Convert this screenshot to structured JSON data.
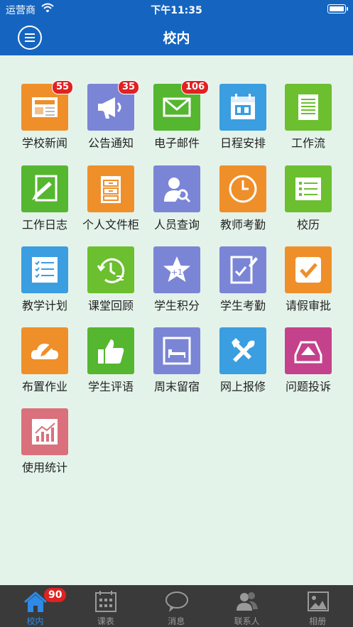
{
  "status": {
    "carrier": "运营商",
    "time": "下午11:35"
  },
  "nav": {
    "title": "校内"
  },
  "colors": {
    "header": "#1565c0",
    "badge": "#e02222",
    "tab_active": "#2e8ae6"
  },
  "apps": [
    {
      "label": "学校新闻",
      "icon": "news-icon",
      "color": "#ef8f2a",
      "badge": "55"
    },
    {
      "label": "公告通知",
      "icon": "megaphone-icon",
      "color": "#7b85d6",
      "badge": "35"
    },
    {
      "label": "电子邮件",
      "icon": "envelope-icon",
      "color": "#55b630",
      "badge": "106"
    },
    {
      "label": "日程安排",
      "icon": "calendar-icon",
      "color": "#3a9ee0",
      "badge": ""
    },
    {
      "label": "工作流",
      "icon": "document-icon",
      "color": "#6cbf2f",
      "badge": ""
    },
    {
      "label": "工作日志",
      "icon": "pencil-note-icon",
      "color": "#55b630",
      "badge": ""
    },
    {
      "label": "个人文件柜",
      "icon": "cabinet-icon",
      "color": "#ef8f2a",
      "badge": ""
    },
    {
      "label": "人员查询",
      "icon": "person-search-icon",
      "color": "#7b85d6",
      "badge": ""
    },
    {
      "label": "教师考勤",
      "icon": "clock-icon",
      "color": "#ef8f2a",
      "badge": ""
    },
    {
      "label": "校历",
      "icon": "list-icon",
      "color": "#6cbf2f",
      "badge": ""
    },
    {
      "label": "教学计划",
      "icon": "checklist-icon",
      "color": "#3a9ee0",
      "badge": ""
    },
    {
      "label": "课堂回顾",
      "icon": "history-icon",
      "color": "#6cbf2f",
      "badge": ""
    },
    {
      "label": "学生积分",
      "icon": "star-icon",
      "color": "#7b85d6",
      "badge": "",
      "icon_text": "+1"
    },
    {
      "label": "学生考勤",
      "icon": "check-edit-icon",
      "color": "#7b85d6",
      "badge": ""
    },
    {
      "label": "请假审批",
      "icon": "approve-icon",
      "color": "#ef8f2a",
      "badge": ""
    },
    {
      "label": "布置作业",
      "icon": "cloud-pencil-icon",
      "color": "#ef8f2a",
      "badge": ""
    },
    {
      "label": "学生评语",
      "icon": "thumbs-up-icon",
      "color": "#55b630",
      "badge": ""
    },
    {
      "label": "周末留宿",
      "icon": "bed-icon",
      "color": "#7b85d6",
      "badge": ""
    },
    {
      "label": "网上报修",
      "icon": "tools-icon",
      "color": "#3a9ee0",
      "badge": ""
    },
    {
      "label": "问题投诉",
      "icon": "mailbox-icon",
      "color": "#c4428c",
      "badge": ""
    },
    {
      "label": "使用统计",
      "icon": "chart-icon",
      "color": "#d9707c",
      "badge": ""
    }
  ],
  "tabs": [
    {
      "label": "校内",
      "icon": "home-icon",
      "active": true,
      "badge": "90"
    },
    {
      "label": "课表",
      "icon": "timetable-icon",
      "active": false,
      "badge": ""
    },
    {
      "label": "消息",
      "icon": "chat-icon",
      "active": false,
      "badge": ""
    },
    {
      "label": "联系人",
      "icon": "contacts-icon",
      "active": false,
      "badge": ""
    },
    {
      "label": "相册",
      "icon": "photo-icon",
      "active": false,
      "badge": ""
    }
  ]
}
